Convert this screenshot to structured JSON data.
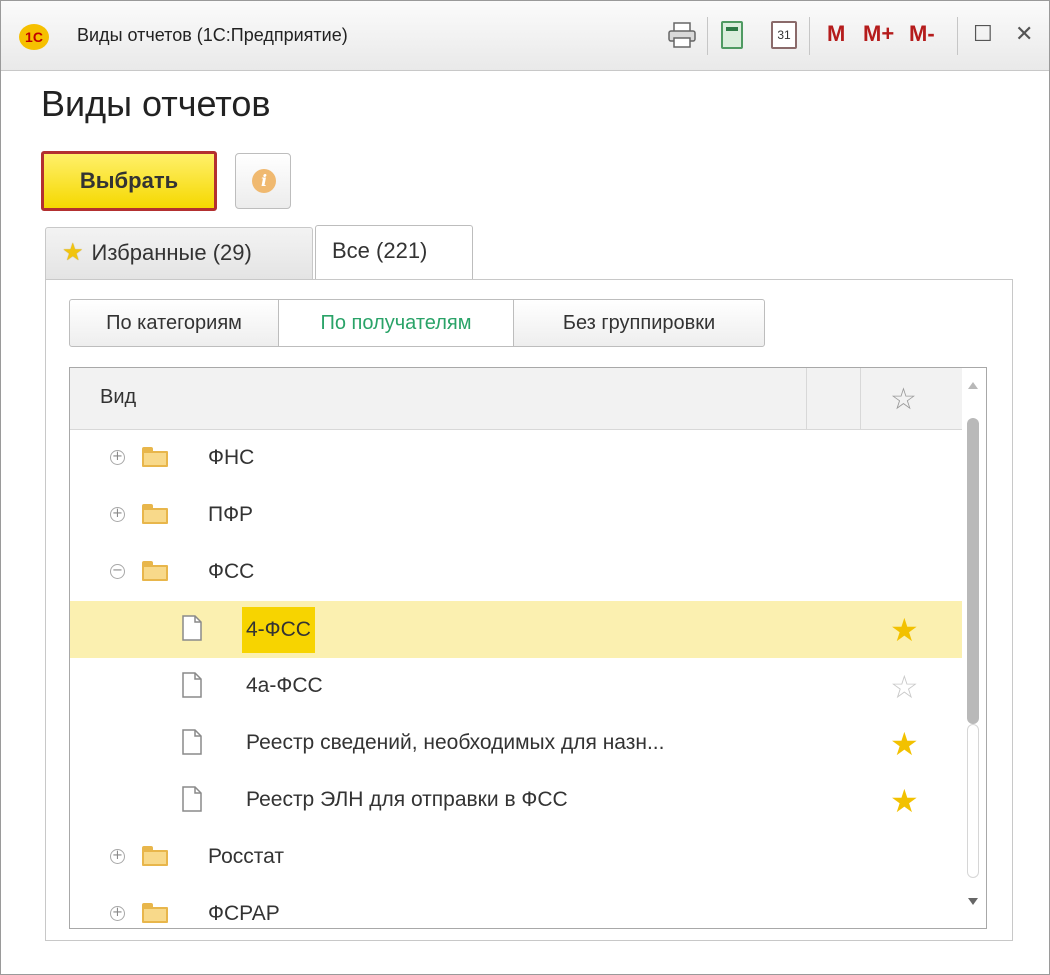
{
  "window": {
    "title": "Виды отчетов  (1С:Предприятие)",
    "logo_text": "1С",
    "toolbar": {
      "calendar_label": "31",
      "m_label": "M",
      "m_plus_label": "M+",
      "m_minus_label": "M-",
      "maximize_symbol": "☐",
      "close_symbol": "✕"
    }
  },
  "page": {
    "title": "Виды отчетов",
    "select_button": "Выбрать",
    "info_symbol": "i"
  },
  "tabs": [
    {
      "label": "Избранные (29)",
      "icon": "star-icon",
      "active": false
    },
    {
      "label": "Все (221)",
      "active": true
    }
  ],
  "grouping": [
    {
      "label": "По категориям",
      "active": false
    },
    {
      "label": "По получателям",
      "active": true
    },
    {
      "label": "Без группировки",
      "active": false
    }
  ],
  "table": {
    "column_vid": "Вид",
    "column_star": "☆",
    "rows": [
      {
        "type": "group",
        "expander": "+",
        "label": "ФНС"
      },
      {
        "type": "group",
        "expander": "+",
        "label": "ПФР"
      },
      {
        "type": "group",
        "expander": "−",
        "label": "ФСС"
      },
      {
        "type": "item",
        "label": "4-ФСС",
        "star": "★",
        "favorite": true,
        "selected": true
      },
      {
        "type": "item",
        "label": "4а-ФСС",
        "star": "☆",
        "favorite": false,
        "selected": false
      },
      {
        "type": "item",
        "label": "Реестр сведений, необходимых для назн...",
        "star": "★",
        "favorite": true,
        "selected": false
      },
      {
        "type": "item",
        "label": "Реестр ЭЛН для отправки в ФСС",
        "star": "★",
        "favorite": true,
        "selected": false
      },
      {
        "type": "group",
        "expander": "+",
        "label": "Росстат"
      },
      {
        "type": "group",
        "expander": "+",
        "label": "ФСРАР"
      }
    ]
  },
  "colors": {
    "accent_yellow": "#f5d800",
    "selected_row": "#fbf0b0",
    "highlight": "#f7d400",
    "active_group_text": "#2aa368",
    "star_on": "#f2c100",
    "memory_buttons": "#b51c1c"
  }
}
